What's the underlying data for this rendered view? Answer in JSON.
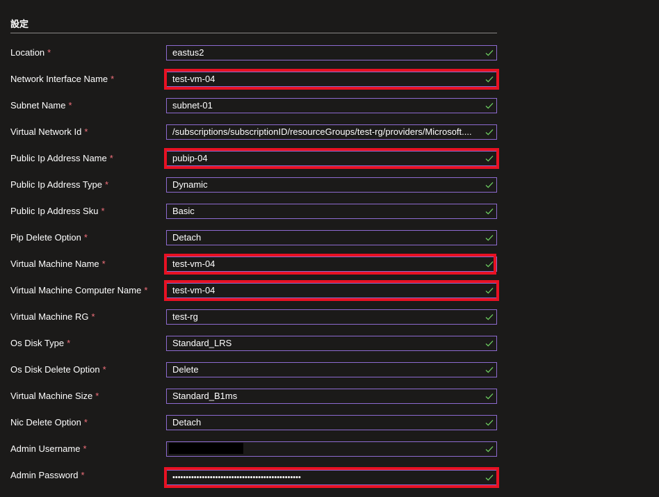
{
  "section": {
    "title": "設定"
  },
  "fields": [
    {
      "label": "Location",
      "value": "eastus2"
    },
    {
      "label": "Network Interface Name",
      "value": "test-vm-04"
    },
    {
      "label": "Subnet Name",
      "value": "subnet-01"
    },
    {
      "label": "Virtual Network Id",
      "value": "/subscriptions/subscriptionID/resourceGroups/test-rg/providers/Microsoft...."
    },
    {
      "label": "Public Ip Address Name",
      "value": "pubip-04"
    },
    {
      "label": "Public Ip Address Type",
      "value": "Dynamic"
    },
    {
      "label": "Public Ip Address Sku",
      "value": "Basic"
    },
    {
      "label": "Pip Delete Option",
      "value": "Detach"
    },
    {
      "label": "Virtual Machine Name",
      "value": "test-vm-04"
    },
    {
      "label": "Virtual Machine Computer Name",
      "value": "test-vm-04"
    },
    {
      "label": "Virtual Machine RG",
      "value": "test-rg"
    },
    {
      "label": "Os Disk Type",
      "value": "Standard_LRS"
    },
    {
      "label": "Os Disk Delete Option",
      "value": "Delete"
    },
    {
      "label": "Virtual Machine Size",
      "value": "Standard_B1ms"
    },
    {
      "label": "Nic Delete Option",
      "value": "Detach"
    },
    {
      "label": "Admin Username",
      "value": ""
    },
    {
      "label": "Admin Password",
      "value": "••••••••••••••••••••••••••••••••••••••••••••••••"
    }
  ],
  "required_marker": "*",
  "colors": {
    "background": "#1b1a19",
    "field_border": "#8e6bd1",
    "required": "#f1707b",
    "valid_check": "#6ccb5f",
    "highlight": "#e81123"
  },
  "icons": {
    "valid": "checkmark-icon"
  }
}
